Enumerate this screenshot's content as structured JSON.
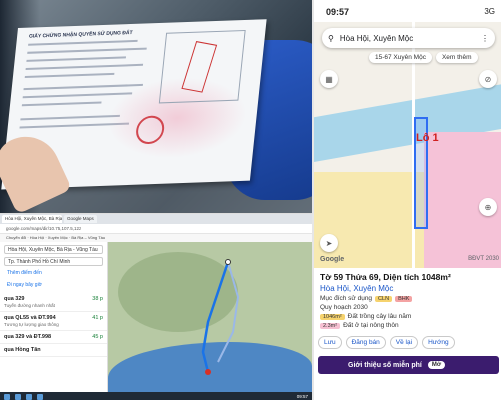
{
  "photo": {
    "doc_heading": "GIẤY CHỨNG NHẬN QUYỀN SỬ DỤNG ĐẤT"
  },
  "phone": {
    "status": {
      "time": "09:57",
      "right": "3G"
    },
    "search": {
      "query": "Hòa Hội, Xuyên Mộc"
    },
    "chips": [
      "15-67 Xuyên Mộc",
      "Xem thêm"
    ],
    "lot_label": "Lô 1",
    "google": "Google",
    "watermark": "BĐVT 2030",
    "info": {
      "title": "Tờ 59 Thửa 69, Diện tích 1048m²",
      "location": "Hòa Hội, Xuyên Mộc",
      "usage_label": "Mục đích sử dụng",
      "usage_tags": [
        "CLN",
        "BHK"
      ],
      "plan_label": "Quy hoạch 2030",
      "plan_rows": [
        {
          "area": "1046m²",
          "desc": "Đất trồng cây lâu năm"
        },
        {
          "area": "2.3m²",
          "desc": "Đất ở tại nông thôn"
        }
      ],
      "actions": [
        "Lưu",
        "Đăng bán",
        "Về lại",
        "Hướng"
      ],
      "ad_text": "Giới thiệu số miễn phí",
      "ad_button": "Mở"
    }
  },
  "desktop": {
    "tabs": [
      "Hòa Hội, Xuyên Mộc, Bà Rịa",
      "Google Maps"
    ],
    "url": "google.com/maps/dir/10.75,107.5,12z",
    "bookmarks": "Chuyển đổi · Hòa Hội · Xuyên Mộc · Bà Rịa – Vũng Tàu",
    "inputs": [
      "Hòa Hội, Xuyên Mộc, Bà Rịa - Vũng Tàu",
      "Tp. Thành Phố Hồ Chí Minh"
    ],
    "add_destination": "Thêm điểm đến",
    "leave_now": "Đi ngay bây giờ",
    "routes": [
      {
        "name": "qua 329",
        "time": "38 p",
        "sub": "Tuyến đường nhanh nhất"
      },
      {
        "name": "qua QL55 và ĐT.994",
        "time": "41 p",
        "sub": "Tương tự lượng giao thông"
      },
      {
        "name": "qua 329 và ĐT.998",
        "time": "45 p",
        "sub": ""
      },
      {
        "name": "qua Hồng Tân",
        "time": "",
        "sub": ""
      }
    ],
    "clock": "09:57"
  }
}
